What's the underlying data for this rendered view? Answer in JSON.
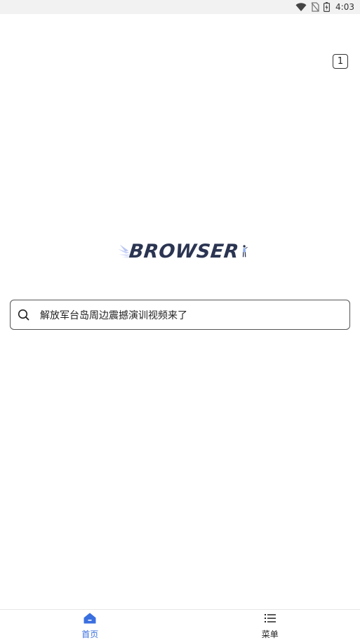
{
  "status_bar": {
    "time": "4:03",
    "icons": [
      "wifi-icon",
      "no-sim-icon",
      "battery-charging-icon"
    ]
  },
  "tabs": {
    "count": "1"
  },
  "logo": {
    "wordmark": "BROWSER"
  },
  "search": {
    "query": "解放军台岛周边震撼演训视频来了",
    "icon": "search-icon"
  },
  "bottom_nav": {
    "items": [
      {
        "label": "首页",
        "icon": "home-icon",
        "active": true
      },
      {
        "label": "菜单",
        "icon": "menu-list-icon",
        "active": false
      }
    ]
  },
  "colors": {
    "accent": "#3a6fdf",
    "logo_text": "#2b3552",
    "status_bar_bg": "#f2f2f2"
  }
}
